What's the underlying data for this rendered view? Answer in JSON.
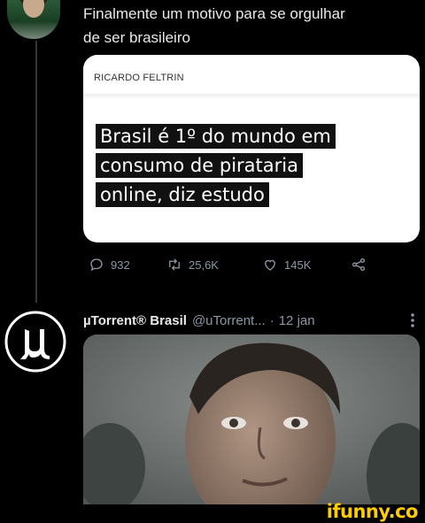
{
  "tweet1": {
    "text_line1": "Finalmente um motivo para se orgulhar",
    "text_line2": "de ser brasileiro",
    "card": {
      "author": "RICARDO FELTRIN",
      "headline_lines": [
        "Brasil é 1º do mundo em",
        "consumo de pirataria",
        "online, diz estudo"
      ]
    },
    "actions": {
      "replies": "932",
      "retweets": "25,6K",
      "likes": "145K"
    },
    "icons": [
      "reply-icon",
      "retweet-icon",
      "like-icon",
      "share-icon"
    ]
  },
  "tweet2": {
    "display_name": "µTorrent® Brasil",
    "handle": "@uTorrent...",
    "separator": "·",
    "date": "12 jan",
    "avatar_icon": "utorrent-logo-icon",
    "more_icon": "more-vertical-icon"
  },
  "watermark": "ifunny.co",
  "colors": {
    "background": "#000000",
    "text": "#e7e9ea",
    "secondary_text": "#8b98a5",
    "card_background": "#ffffff",
    "headline_background": "#111111",
    "watermark": "#ffcc00"
  }
}
